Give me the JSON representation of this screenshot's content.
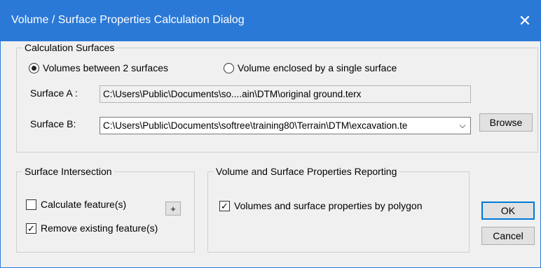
{
  "window": {
    "title": "Volume / Surface Properties Calculation Dialog"
  },
  "calc_surfaces": {
    "group_label": "Calculation Surfaces",
    "radio_between": "Volumes between 2 surfaces",
    "radio_single": "Volume enclosed by a single surface",
    "selected": "between",
    "surface_a_label": "Surface A :",
    "surface_a_value": "C:\\Users\\Public\\Documents\\so....ain\\DTM\\original ground.terx",
    "surface_b_label": "Surface B:",
    "surface_b_value": "C:\\Users\\Public\\Documents\\softree\\training80\\Terrain\\DTM\\excavation.te",
    "browse_label": "Browse"
  },
  "intersection": {
    "group_label": "Surface Intersection",
    "calc_features_label": "Calculate feature(s)",
    "calc_features_checked": false,
    "remove_existing_label": "Remove existing feature(s)",
    "remove_existing_checked": true,
    "plus_label": "+"
  },
  "reporting": {
    "group_label": "Volume and Surface Properties Reporting",
    "by_polygon_label": "Volumes and surface properties by polygon",
    "by_polygon_checked": true
  },
  "actions": {
    "ok_label": "OK",
    "cancel_label": "Cancel"
  },
  "icons": {
    "close": "close-icon",
    "dropdown": "chevron-down-icon",
    "check": "checkmark-icon"
  },
  "colors": {
    "titlebar": "#2b79d7",
    "dialog_bg": "#f0f0f0",
    "default_button_border": "#0078d7"
  }
}
